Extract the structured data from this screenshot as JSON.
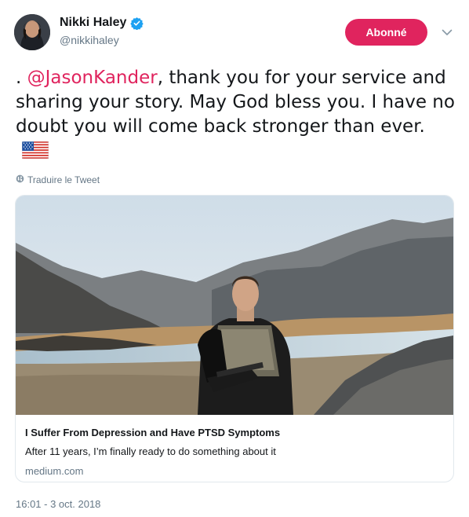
{
  "author": {
    "display_name": "Nikki Haley",
    "handle": "@nikkihaley",
    "verified": true
  },
  "follow_button": {
    "label": "Abonné",
    "color": "#e0245e"
  },
  "tweet": {
    "prefix": ". ",
    "mention": "@JasonKander",
    "body": ", thank you for your service and sharing your story. May God bless you. I have no doubt you will come back stronger than ever.",
    "emoji": "us-flag"
  },
  "translate_label": "Traduire le Tweet",
  "card": {
    "title": "I Suffer From Depression and Have PTSD Symptoms",
    "description": "After 11 years, I’m finally ready to do something about it",
    "domain": "medium.com"
  },
  "timestamp": "16:01 - 3 oct. 2018",
  "colors": {
    "accent": "#e0245e",
    "verified": "#1da1f2",
    "muted": "#657786"
  }
}
